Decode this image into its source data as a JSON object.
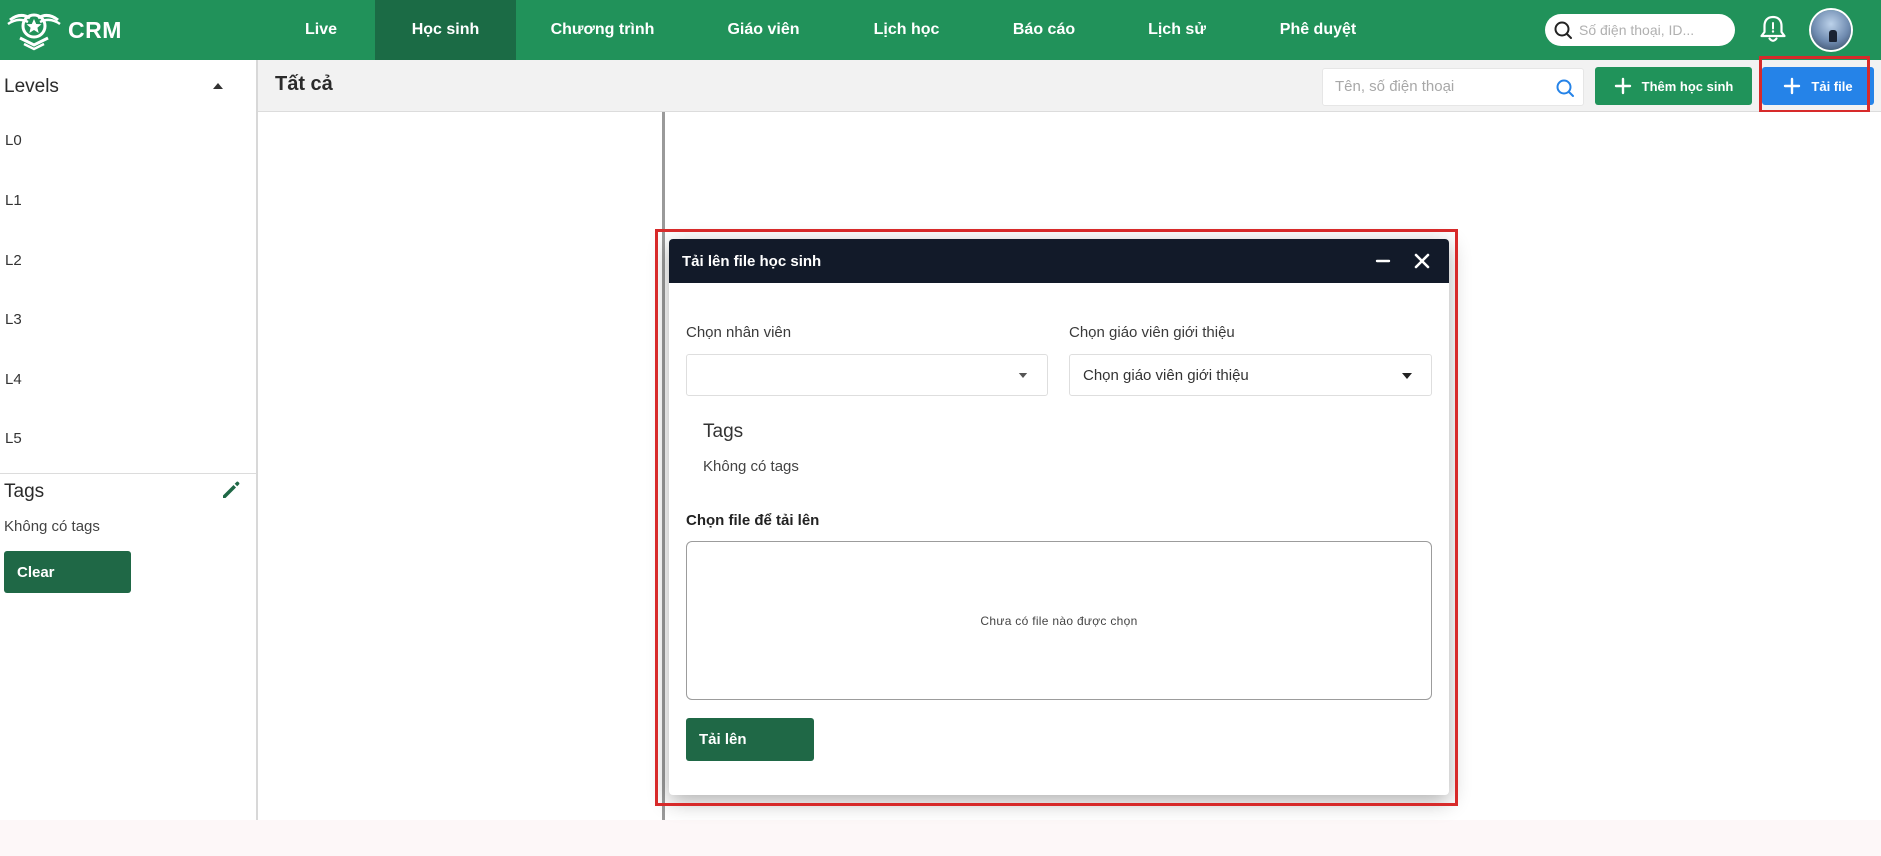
{
  "brand": {
    "name": "CRM"
  },
  "nav": {
    "items": [
      {
        "label": "Live",
        "active": false
      },
      {
        "label": "Học sinh",
        "active": true
      },
      {
        "label": "Chương trình",
        "active": false
      },
      {
        "label": "Giáo viên",
        "active": false
      },
      {
        "label": "Lịch học",
        "active": false
      },
      {
        "label": "Báo cáo",
        "active": false
      },
      {
        "label": "Lịch sử",
        "active": false
      },
      {
        "label": "Phê duyệt",
        "active": false
      }
    ],
    "search_placeholder": "Số điện thoại, ID..."
  },
  "sidebar": {
    "levels_title": "Levels",
    "levels": [
      "L0",
      "L1",
      "L2",
      "L3",
      "L4",
      "L5"
    ],
    "tags_title": "Tags",
    "no_tags": "Không có tags",
    "clear_label": "Clear"
  },
  "main": {
    "title": "Tất cả",
    "search_placeholder": "Tên, số điện thoại",
    "add_student_label": "Thêm học sinh",
    "upload_label": "Tải file"
  },
  "modal": {
    "title": "Tải lên file học sinh",
    "staff_label": "Chọn nhân viên",
    "staff_value": "",
    "teacher_label": "Chọn giáo viên giới thiệu",
    "teacher_value": "Chọn giáo viên giới thiệu",
    "tags_title": "Tags",
    "no_tags": "Không có tags",
    "file_label": "Chọn file để tải lên",
    "no_file_text": "Chưa có file nào được chọn",
    "submit_label": "Tải lên"
  },
  "colors": {
    "nav_bg": "#21925a",
    "nav_active_bg": "#1b6b45",
    "primary_dark": "#1f6846",
    "upload_blue": "#2583e8",
    "modal_header": "#121a29",
    "highlight_red": "#d72a2a"
  }
}
